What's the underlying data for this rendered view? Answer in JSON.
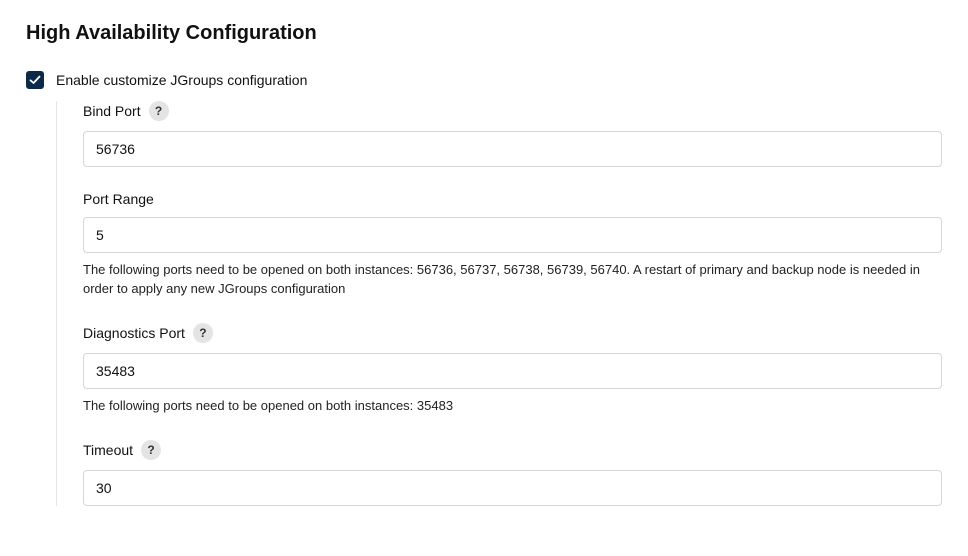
{
  "title": "High Availability Configuration",
  "enable": {
    "label": "Enable customize JGroups configuration",
    "checked": true
  },
  "fields": {
    "bind_port": {
      "label": "Bind Port",
      "value": "56736",
      "help_icon": "?"
    },
    "port_range": {
      "label": "Port Range",
      "value": "5",
      "help_text": "The following ports need to be opened on both instances: 56736, 56737, 56738, 56739, 56740. A restart of primary and backup node is needed in order to apply any new JGroups configuration"
    },
    "diagnostics_port": {
      "label": "Diagnostics Port",
      "value": "35483",
      "help_icon": "?",
      "help_text": "The following ports need to be opened on both instances: 35483"
    },
    "timeout": {
      "label": "Timeout",
      "value": "30",
      "help_icon": "?"
    }
  }
}
